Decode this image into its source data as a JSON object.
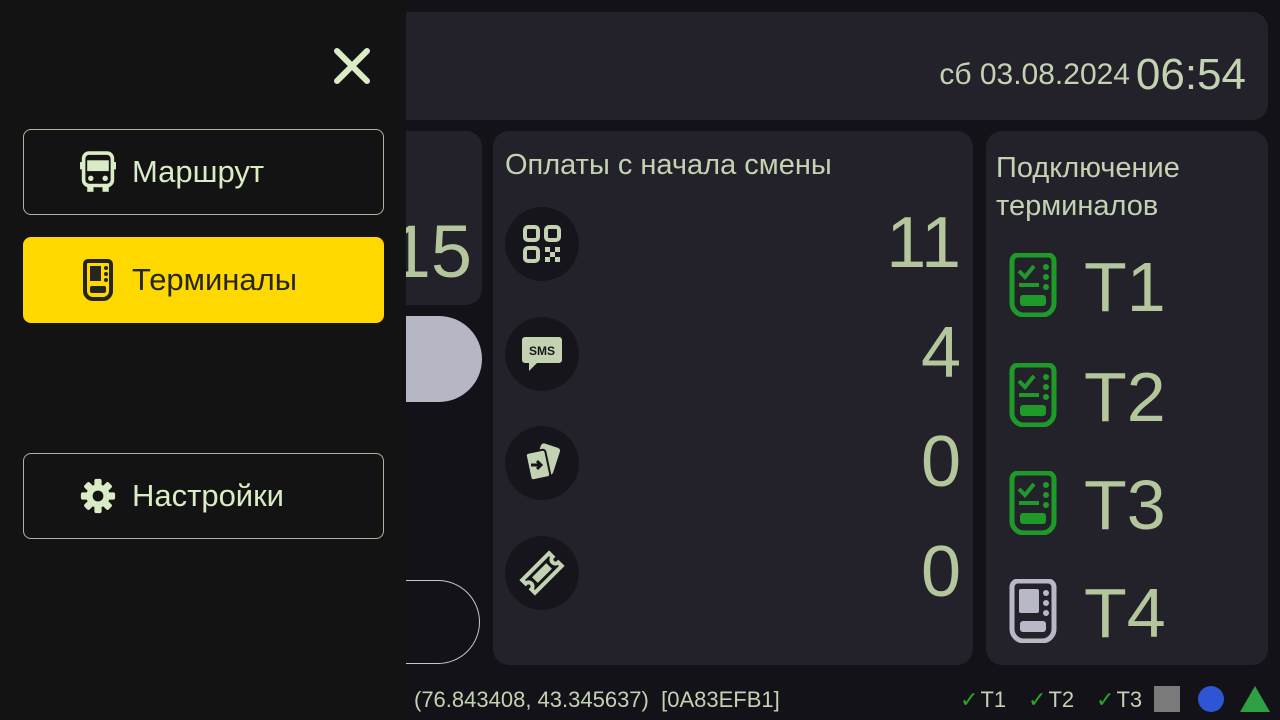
{
  "header": {
    "date": "сб 03.08.2024",
    "time": "06:54"
  },
  "left_card": {
    "number": "15"
  },
  "payments": {
    "title": "Оплаты с начала смены",
    "rows": [
      {
        "icon": "qr-code-icon",
        "value": "11"
      },
      {
        "icon": "sms-icon",
        "value": "4"
      },
      {
        "icon": "card-transfer-icon",
        "value": "0"
      },
      {
        "icon": "ticket-icon",
        "value": "0"
      }
    ]
  },
  "terminals": {
    "title": "Подключение терминалов",
    "items": [
      {
        "label": "T1",
        "status": "connected",
        "color": "#1e9a29"
      },
      {
        "label": "T2",
        "status": "connected",
        "color": "#1e9a29"
      },
      {
        "label": "T3",
        "status": "connected",
        "color": "#1e9a29"
      },
      {
        "label": "T4",
        "status": "disconnected",
        "color": "#b9b8c6"
      }
    ]
  },
  "status_bar": {
    "coordinates": "(76.843408, 43.345637)",
    "device_id": "[0A83EFB1]",
    "terminals": [
      "T1",
      "T2",
      "T3"
    ],
    "indicators": [
      {
        "icon": "square-indicator-icon",
        "color": "#7a7a7a"
      },
      {
        "icon": "circle-indicator-icon",
        "color": "#2f55d4"
      },
      {
        "icon": "triangle-indicator-icon",
        "color": "#2ea043"
      }
    ]
  },
  "drawer": {
    "close_icon": "close-icon",
    "menu": [
      {
        "label": "Маршрут",
        "icon": "bus-icon",
        "active": false
      },
      {
        "label": "Терминалы",
        "icon": "terminal-icon",
        "active": true
      },
      {
        "label": "Настройки",
        "icon": "gear-icon",
        "active": false
      }
    ]
  },
  "colors": {
    "accent": "#ffd800",
    "text": "#c3d3b2",
    "connected": "#1e9a29",
    "disconnected": "#b9b8c6",
    "panel": "#23222b"
  }
}
